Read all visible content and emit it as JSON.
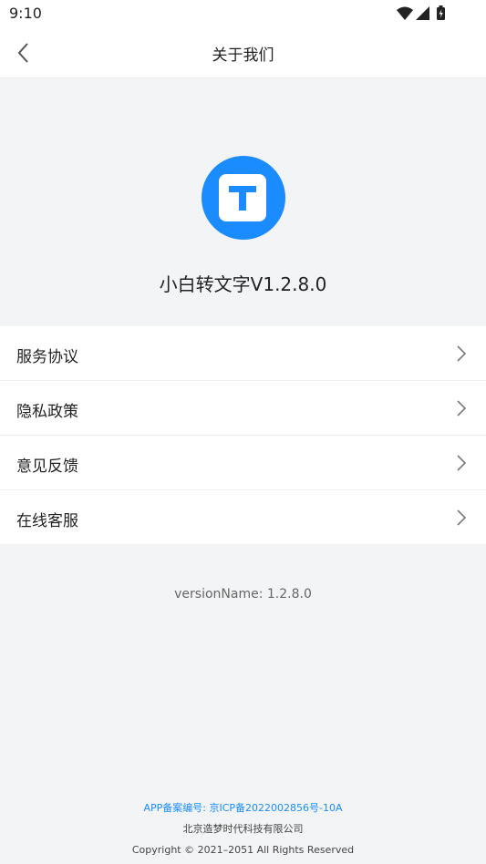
{
  "status_bar": {
    "time": "9:10",
    "icons": [
      "wifi-icon",
      "signal-icon",
      "battery-icon"
    ]
  },
  "header": {
    "title": "关于我们",
    "back_icon": "chevron-left-icon"
  },
  "app": {
    "logo_letter": "T",
    "logo_color": "#1a8cff",
    "name_version": "小白转文字V1.2.8.0"
  },
  "menu": {
    "items": [
      {
        "label": "服务协议"
      },
      {
        "label": "隐私政策"
      },
      {
        "label": "意见反馈"
      },
      {
        "label": "在线客服"
      }
    ]
  },
  "version_text": "versionName: 1.2.8.0",
  "footer": {
    "icp": "APP备案编号: 京ICP备2022002856号-10A",
    "company": "北京造梦时代科技有限公司",
    "copyright": "Copyright © 2021–2051 All Rights Reserved"
  }
}
